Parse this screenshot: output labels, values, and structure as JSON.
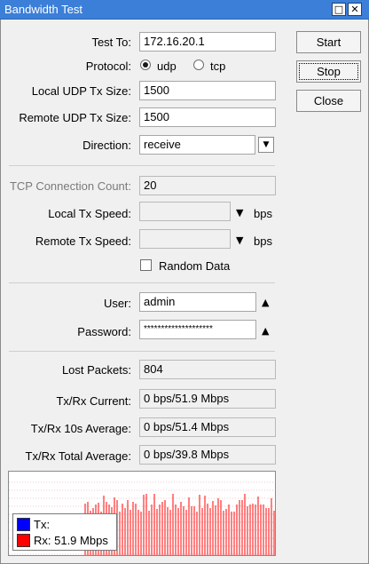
{
  "window": {
    "title": "Bandwidth Test"
  },
  "form": {
    "test_to": {
      "label": "Test To:",
      "value": "172.16.20.1"
    },
    "protocol": {
      "label": "Protocol:",
      "options": [
        "udp",
        "tcp"
      ],
      "selected": "udp"
    },
    "local_udp_tx_size": {
      "label": "Local UDP Tx Size:",
      "value": "1500"
    },
    "remote_udp_tx_size": {
      "label": "Remote UDP Tx Size:",
      "value": "1500"
    },
    "direction": {
      "label": "Direction:",
      "value": "receive"
    },
    "tcp_connection_count": {
      "label": "TCP Connection Count:",
      "value": "20"
    },
    "local_tx_speed": {
      "label": "Local Tx Speed:",
      "value": "",
      "unit": "bps"
    },
    "remote_tx_speed": {
      "label": "Remote Tx Speed:",
      "value": "",
      "unit": "bps"
    },
    "random_data": {
      "label": "Random Data",
      "checked": false
    },
    "user": {
      "label": "User:",
      "value": "admin"
    },
    "password": {
      "label": "Password:",
      "value": "********************"
    }
  },
  "stats": {
    "lost_packets": {
      "label": "Lost Packets:",
      "value": "804"
    },
    "tx_rx_current": {
      "label": "Tx/Rx Current:",
      "value": "0 bps/51.9 Mbps"
    },
    "tx_rx_10s_avg": {
      "label": "Tx/Rx 10s Average:",
      "value": "0 bps/51.4 Mbps"
    },
    "tx_rx_total_avg": {
      "label": "Tx/Rx Total Average:",
      "value": "0 bps/39.8 Mbps"
    }
  },
  "buttons": {
    "start": "Start",
    "stop": "Stop",
    "close": "Close"
  },
  "legend": {
    "tx_label": "Tx:",
    "tx_color": "#0000ff",
    "rx_label": "Rx:  51.9 Mbps",
    "rx_color": "#ff0000"
  },
  "icons": {
    "maximize": "maximize-icon",
    "close": "close-icon",
    "dropdown": "triangle-down-icon",
    "collapse": "triangle-up-icon"
  }
}
